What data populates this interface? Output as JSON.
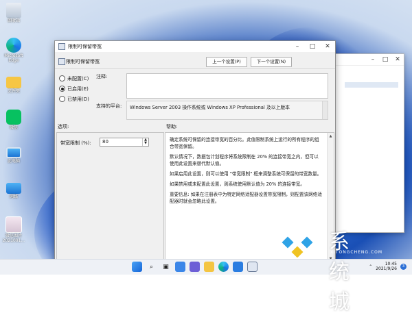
{
  "desktop": {
    "icons": [
      {
        "label": "回收站",
        "icon": "recycle-bin-icon"
      },
      {
        "label": "Microsoft Edge",
        "icon": "edge-icon"
      },
      {
        "label": "文件夹",
        "icon": "folder-icon"
      },
      {
        "label": "微信",
        "icon": "wechat-icon"
      },
      {
        "label": "此电脑",
        "icon": "computer-icon"
      },
      {
        "label": "网络",
        "icon": "network-icon"
      },
      {
        "label": "微信图片 2021091...",
        "icon": "image-file-icon"
      }
    ]
  },
  "dialog": {
    "title": "限制可保留带宽",
    "setting_name": "限制可保留带宽",
    "prev_button": "上一个设置(P)",
    "next_button": "下一个设置(N)",
    "radios": [
      {
        "label": "未配置(C)",
        "checked": false
      },
      {
        "label": "已启用(E)",
        "checked": true
      },
      {
        "label": "已禁用(D)",
        "checked": false
      }
    ],
    "comment_label": "注释:",
    "comment_value": "",
    "supported_label": "支持的平台:",
    "supported_value": "Windows Server 2003 操作系统或 Windows XP Professional 及以上版本",
    "options_label": "选项:",
    "help_label": "帮助:",
    "bandwidth_label": "带宽限制 (%):",
    "bandwidth_value": "80",
    "help_paragraphs": [
      "确定系统可保留的连接带宽的百分比。此值限制系统上运行的所有程序的组合带宽保留。",
      "默认情况下，数据包计划程序将系统限制在 20% 的连接带宽之内，但可以使用此设置来替代默认值。",
      "如果启用此设置，则可以使用 \"带宽限制\" 框来调整系统可保留的带宽数量。",
      "如果禁用或未配置此设置，则系统使用默认值为 20% 的连接带宽。",
      "重要信息: 如果在注册表中为特定网络适配器设置带宽限制，则配置该网络适配器时就会忽略此设置。"
    ]
  },
  "taskbar": {
    "time": "10:45",
    "date": "2021/9/26",
    "notification_count": "3"
  },
  "watermark": {
    "cn": "系统城",
    "en": "XITONGCHENG.COM"
  }
}
